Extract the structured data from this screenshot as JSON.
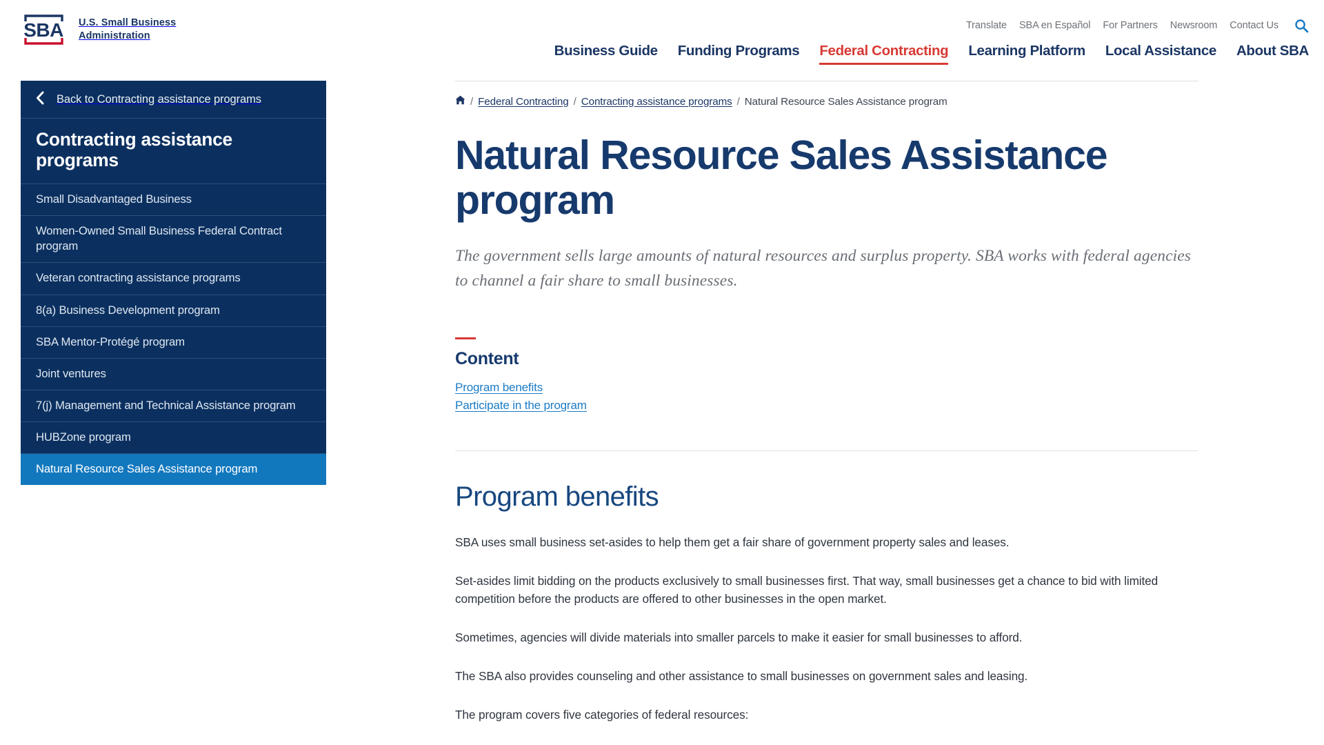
{
  "header": {
    "logo": {
      "mark_alt": "sba-logo-icon",
      "text": "U.S. Small Business\nAdministration"
    },
    "utility_nav": [
      {
        "label": "Translate"
      },
      {
        "label": "SBA en Español"
      },
      {
        "label": "For Partners"
      },
      {
        "label": "Newsroom"
      },
      {
        "label": "Contact Us"
      }
    ],
    "search_icon": "search-icon",
    "main_nav": [
      {
        "label": "Business Guide",
        "active": false
      },
      {
        "label": "Funding Programs",
        "active": false
      },
      {
        "label": "Federal Contracting",
        "active": true
      },
      {
        "label": "Learning Platform",
        "active": false
      },
      {
        "label": "Local Assistance",
        "active": false
      },
      {
        "label": "About SBA",
        "active": false
      }
    ]
  },
  "sidebar": {
    "back_label": "Back to Contracting assistance programs",
    "back_icon": "chevron-left-icon",
    "heading": "Contracting assistance programs",
    "items": [
      {
        "label": "Small Disadvantaged Business",
        "active": false
      },
      {
        "label": "Women-Owned Small Business Federal Contract program",
        "active": false
      },
      {
        "label": "Veteran contracting assistance programs",
        "active": false
      },
      {
        "label": "8(a) Business Development program",
        "active": false
      },
      {
        "label": "SBA Mentor-Protégé program",
        "active": false
      },
      {
        "label": "Joint ventures",
        "active": false
      },
      {
        "label": "7(j) Management and Technical Assistance program",
        "active": false
      },
      {
        "label": "HUBZone program",
        "active": false
      },
      {
        "label": "Natural Resource Sales Assistance program",
        "active": true
      }
    ]
  },
  "breadcrumb": {
    "home_icon": "home-icon",
    "separator": "/",
    "items": [
      {
        "label": "Federal Contracting",
        "is_link": true
      },
      {
        "label": "Contracting assistance programs",
        "is_link": true
      },
      {
        "label": "Natural Resource Sales Assistance program",
        "is_link": false
      }
    ]
  },
  "page": {
    "title": "Natural Resource Sales Assistance program",
    "subtitle": "The government sells large amounts of natural resources and surplus property. SBA works with federal agencies to channel a fair share to small businesses.",
    "content_heading": "Content",
    "content_links": [
      {
        "label": "Program benefits"
      },
      {
        "label": "Participate in the program"
      }
    ],
    "sections": [
      {
        "heading": "Program benefits",
        "paragraphs": [
          "SBA uses small business set-asides to help them get a fair share of government property sales and leases.",
          "Set-asides limit bidding on the products exclusively to small businesses first. That way, small businesses get a chance to bid with limited competition before the products are offered to other businesses in the open market.",
          "Sometimes, agencies will divide materials into smaller parcels to make it easier for small businesses to afford.",
          "The SBA also provides counseling and other assistance to small businesses on government sales and leasing.",
          "The program covers five categories of federal resources:"
        ]
      }
    ]
  },
  "colors": {
    "navy": "#1b3664",
    "sidebar_bg": "#0b3060",
    "sidebar_active": "#1278be",
    "accent_red": "#d83933",
    "link_blue": "#1a7bc4",
    "heading_blue": "#17477f",
    "muted_gray": "#6d7278"
  }
}
